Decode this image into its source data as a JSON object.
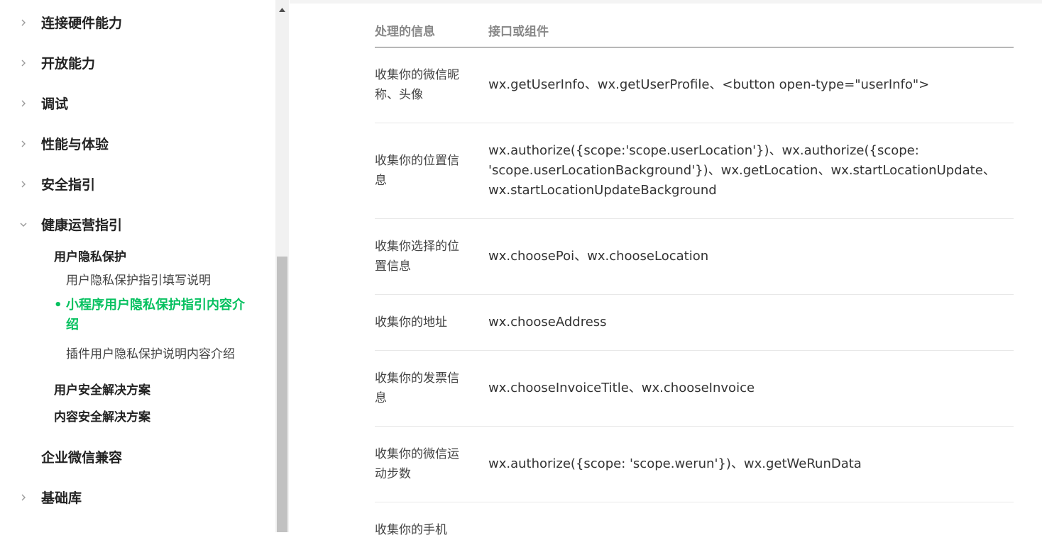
{
  "sidebar": {
    "items": [
      {
        "label": "连接硬件能力",
        "expanded": false
      },
      {
        "label": "开放能力",
        "expanded": false
      },
      {
        "label": "调试",
        "expanded": false
      },
      {
        "label": "性能与体验",
        "expanded": false
      },
      {
        "label": "安全指引",
        "expanded": false
      },
      {
        "label": "健康运营指引",
        "expanded": true
      }
    ],
    "group_privacy": "用户隐私保护",
    "sub_items": [
      "用户隐私保护指引填写说明",
      "小程序用户隐私保护指引内容介绍",
      "插件用户隐私保护说明内容介绍"
    ],
    "active_dot": "•",
    "group_security": "用户安全解决方案",
    "group_content": "内容安全解决方案",
    "wecom": "企业微信兼容",
    "base_lib": "基础库",
    "accent_color": "#07c160"
  },
  "table": {
    "headers": [
      "处理的信息",
      "接口或组件"
    ],
    "rows": [
      {
        "info": "收集你的微信昵称、头像",
        "api": "wx.getUserInfo、wx.getUserProfile、<button open-type=\"userInfo\">"
      },
      {
        "info": "收集你的位置信息",
        "api": "wx.authorize({scope:'scope.userLocation'})、wx.authorize({scope: 'scope.userLocationBackground'})、wx.getLocation、wx.startLocationUpdate、wx.startLocationUpdateBackground"
      },
      {
        "info": "收集你选择的位置信息",
        "api": "wx.choosePoi、wx.chooseLocation"
      },
      {
        "info": "收集你的地址",
        "api": "wx.chooseAddress"
      },
      {
        "info": "收集你的发票信息",
        "api": "wx.chooseInvoiceTitle、wx.chooseInvoice"
      },
      {
        "info": "收集你的微信运动步数",
        "api": "wx.authorize({scope: 'scope.werun'})、wx.getWeRunData"
      },
      {
        "info": "收集你的手机",
        "api": ""
      }
    ]
  }
}
